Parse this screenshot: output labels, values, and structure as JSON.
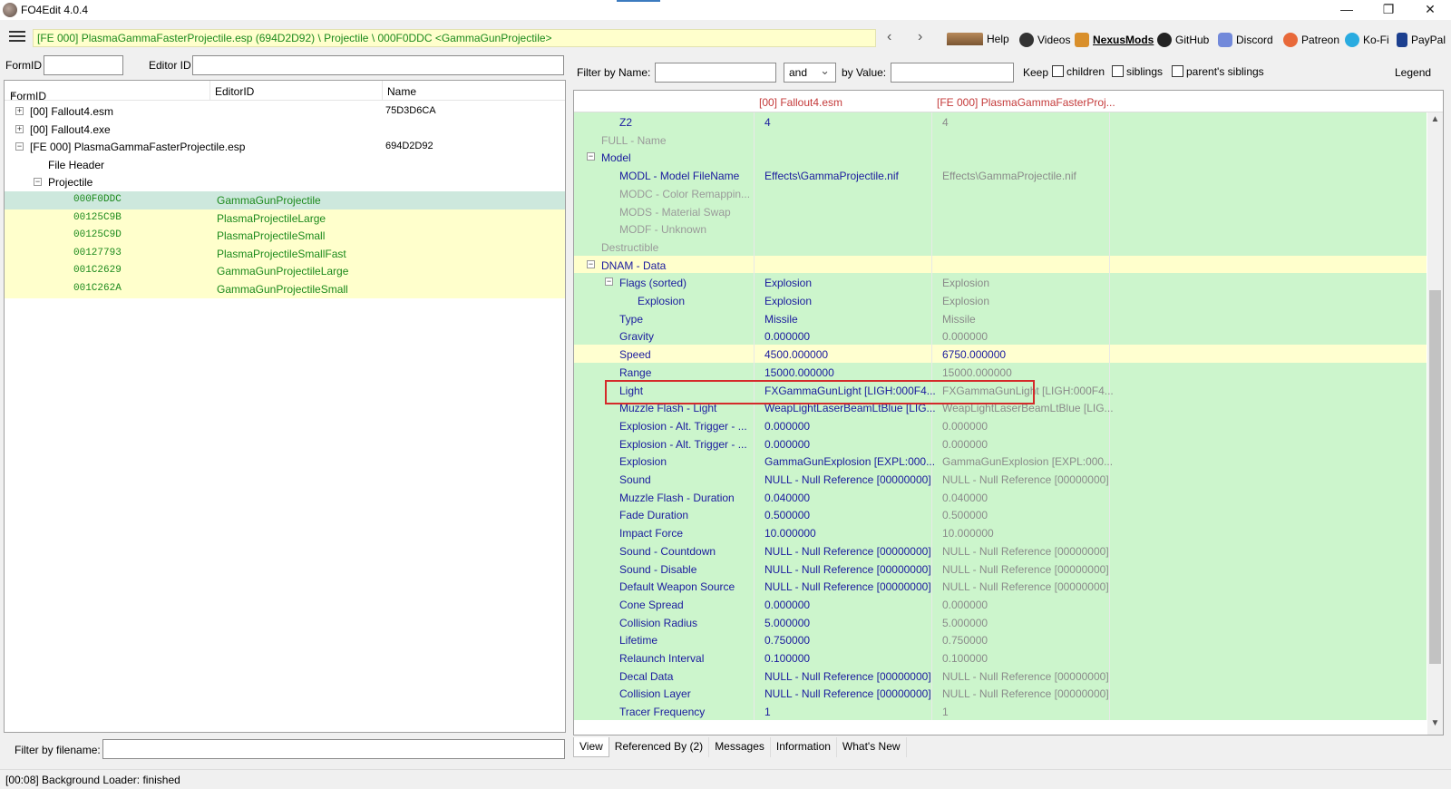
{
  "window": {
    "title": "FO4Edit 4.0.4",
    "minimize": "—",
    "restore": "❐",
    "close": "✕"
  },
  "toolbar": {
    "path": "[FE 000] PlasmaGammaFasterProjectile.esp (694D2D92) \\ Projectile \\ 000F0DDC <GammaGunProjectile>",
    "back": "‹",
    "forward": "›",
    "links": [
      {
        "label": "Help",
        "icon": "book-icon"
      },
      {
        "label": "Videos",
        "icon": "film-icon"
      },
      {
        "label": "NexusMods",
        "icon": "nexus-icon"
      },
      {
        "label": "GitHub",
        "icon": "github-icon"
      },
      {
        "label": "Discord",
        "icon": "discord-icon"
      },
      {
        "label": "Patreon",
        "icon": "patreon-icon"
      },
      {
        "label": "Ko-Fi",
        "icon": "kofi-icon"
      },
      {
        "label": "PayPal",
        "icon": "paypal-icon"
      }
    ]
  },
  "left": {
    "formid_label": "FormID",
    "editorid_label": "Editor ID",
    "columns": [
      "FormID",
      "EditorID",
      "Name"
    ],
    "sort_arrow": "▲",
    "tree": [
      {
        "expander": "+",
        "formid": "[00] Fallout4.esm",
        "editorid": "",
        "name": "75D3D6CA"
      },
      {
        "expander": "+",
        "formid": "[00] Fallout4.exe",
        "editorid": "",
        "name": ""
      },
      {
        "expander": "−",
        "formid": "[FE 000] PlasmaGammaFasterProjectile.esp",
        "editorid": "",
        "name": "694D2D92"
      },
      {
        "expander": "",
        "formid": "File Header",
        "editorid": "",
        "name": ""
      },
      {
        "expander": "−",
        "formid": "Projectile",
        "editorid": "",
        "name": ""
      },
      {
        "expander": "",
        "formid": "000F0DDC",
        "editorid": "GammaGunProjectile",
        "name": ""
      },
      {
        "expander": "",
        "formid": "00125C9B",
        "editorid": "PlasmaProjectileLarge",
        "name": ""
      },
      {
        "expander": "",
        "formid": "00125C9D",
        "editorid": "PlasmaProjectileSmall",
        "name": ""
      },
      {
        "expander": "",
        "formid": "00127793",
        "editorid": "PlasmaProjectileSmallFast",
        "name": ""
      },
      {
        "expander": "",
        "formid": "001C2629",
        "editorid": "GammaGunProjectileLarge",
        "name": ""
      },
      {
        "expander": "",
        "formid": "001C262A",
        "editorid": "GammaGunProjectileSmall",
        "name": ""
      }
    ],
    "filter_label": "Filter by filename:"
  },
  "right": {
    "filter_name_label": "Filter by Name:",
    "and_value": "and",
    "by_value_label": "by Value:",
    "keep_label": "Keep",
    "children_label": "children",
    "siblings_label": "siblings",
    "parents_siblings_label": "parent's siblings",
    "legend_label": "Legend",
    "columns": [
      "[00] Fallout4.esm",
      "[FE 000] PlasmaGammaFasterProj..."
    ],
    "rows": [
      {
        "level": 1,
        "exp": "",
        "key": "Z2",
        "v1": "4",
        "v2": "4",
        "style": ""
      },
      {
        "level": 0,
        "exp": "",
        "key": "FULL - Name",
        "v1": "",
        "v2": "",
        "style": "grey"
      },
      {
        "level": 0,
        "exp": "−",
        "key": "Model",
        "v1": "",
        "v2": "",
        "style": ""
      },
      {
        "level": 1,
        "exp": "",
        "key": "MODL - Model FileName",
        "v1": "Effects\\GammaProjectile.nif",
        "v2": "Effects\\GammaProjectile.nif",
        "style": ""
      },
      {
        "level": 1,
        "exp": "",
        "key": "MODC - Color Remappin...",
        "v1": "",
        "v2": "",
        "style": "grey"
      },
      {
        "level": 1,
        "exp": "",
        "key": "MODS - Material Swap",
        "v1": "",
        "v2": "",
        "style": "grey"
      },
      {
        "level": 1,
        "exp": "",
        "key": "MODF - Unknown",
        "v1": "",
        "v2": "",
        "style": "grey"
      },
      {
        "level": 0,
        "exp": "",
        "key": "Destructible",
        "v1": "",
        "v2": "",
        "style": "grey"
      },
      {
        "level": 0,
        "exp": "−",
        "key": "DNAM - Data",
        "v1": "",
        "v2": "",
        "style": "yellow"
      },
      {
        "level": 1,
        "exp": "−",
        "key": "Flags (sorted)",
        "v1": "Explosion",
        "v2": "Explosion",
        "style": ""
      },
      {
        "level": 2,
        "exp": "",
        "key": "Explosion",
        "v1": "Explosion",
        "v2": "Explosion",
        "style": ""
      },
      {
        "level": 1,
        "exp": "",
        "key": "Type",
        "v1": "Missile",
        "v2": "Missile",
        "style": ""
      },
      {
        "level": 1,
        "exp": "",
        "key": "Gravity",
        "v1": "0.000000",
        "v2": "0.000000",
        "style": ""
      },
      {
        "level": 1,
        "exp": "",
        "key": "Speed",
        "v1": "4500.000000",
        "v2": "6750.000000",
        "style": "selected"
      },
      {
        "level": 1,
        "exp": "",
        "key": "Range",
        "v1": "15000.000000",
        "v2": "15000.000000",
        "style": ""
      },
      {
        "level": 1,
        "exp": "",
        "key": "Light",
        "v1": "FXGammaGunLight [LIGH:000F4...",
        "v2": "FXGammaGunLight [LIGH:000F4...",
        "style": ""
      },
      {
        "level": 1,
        "exp": "",
        "key": "Muzzle Flash - Light",
        "v1": "WeapLightLaserBeamLtBlue [LIG...",
        "v2": "WeapLightLaserBeamLtBlue [LIG...",
        "style": ""
      },
      {
        "level": 1,
        "exp": "",
        "key": "Explosion - Alt. Trigger - ...",
        "v1": "0.000000",
        "v2": "0.000000",
        "style": ""
      },
      {
        "level": 1,
        "exp": "",
        "key": "Explosion - Alt. Trigger - ...",
        "v1": "0.000000",
        "v2": "0.000000",
        "style": ""
      },
      {
        "level": 1,
        "exp": "",
        "key": "Explosion",
        "v1": "GammaGunExplosion [EXPL:000...",
        "v2": "GammaGunExplosion [EXPL:000...",
        "style": ""
      },
      {
        "level": 1,
        "exp": "",
        "key": "Sound",
        "v1": "NULL - Null Reference [00000000]",
        "v2": "NULL - Null Reference [00000000]",
        "style": ""
      },
      {
        "level": 1,
        "exp": "",
        "key": "Muzzle Flash - Duration",
        "v1": "0.040000",
        "v2": "0.040000",
        "style": ""
      },
      {
        "level": 1,
        "exp": "",
        "key": "Fade Duration",
        "v1": "0.500000",
        "v2": "0.500000",
        "style": ""
      },
      {
        "level": 1,
        "exp": "",
        "key": "Impact Force",
        "v1": "10.000000",
        "v2": "10.000000",
        "style": ""
      },
      {
        "level": 1,
        "exp": "",
        "key": "Sound - Countdown",
        "v1": "NULL - Null Reference [00000000]",
        "v2": "NULL - Null Reference [00000000]",
        "style": ""
      },
      {
        "level": 1,
        "exp": "",
        "key": "Sound - Disable",
        "v1": "NULL - Null Reference [00000000]",
        "v2": "NULL - Null Reference [00000000]",
        "style": ""
      },
      {
        "level": 1,
        "exp": "",
        "key": "Default Weapon Source",
        "v1": "NULL - Null Reference [00000000]",
        "v2": "NULL - Null Reference [00000000]",
        "style": ""
      },
      {
        "level": 1,
        "exp": "",
        "key": "Cone Spread",
        "v1": "0.000000",
        "v2": "0.000000",
        "style": ""
      },
      {
        "level": 1,
        "exp": "",
        "key": "Collision Radius",
        "v1": "5.000000",
        "v2": "5.000000",
        "style": ""
      },
      {
        "level": 1,
        "exp": "",
        "key": "Lifetime",
        "v1": "0.750000",
        "v2": "0.750000",
        "style": ""
      },
      {
        "level": 1,
        "exp": "",
        "key": "Relaunch Interval",
        "v1": "0.100000",
        "v2": "0.100000",
        "style": ""
      },
      {
        "level": 1,
        "exp": "",
        "key": "Decal Data",
        "v1": "NULL - Null Reference [00000000]",
        "v2": "NULL - Null Reference [00000000]",
        "style": ""
      },
      {
        "level": 1,
        "exp": "",
        "key": "Collision Layer",
        "v1": "NULL - Null Reference [00000000]",
        "v2": "NULL - Null Reference [00000000]",
        "style": ""
      },
      {
        "level": 1,
        "exp": "",
        "key": "Tracer Frequency",
        "v1": "1",
        "v2": "1",
        "style": ""
      }
    ],
    "tabs": [
      "View",
      "Referenced By (2)",
      "Messages",
      "Information",
      "What's New"
    ],
    "scroll_up": "▲",
    "scroll_down": "▼"
  },
  "status": "[00:08] Background Loader: finished",
  "colors": {
    "green_text": "#1c8a1c",
    "key_text": "#1a1a9e",
    "row_green": "#ccf5cc",
    "row_yellow": "#ffffcc",
    "highlight_red": "#d42a2a"
  }
}
